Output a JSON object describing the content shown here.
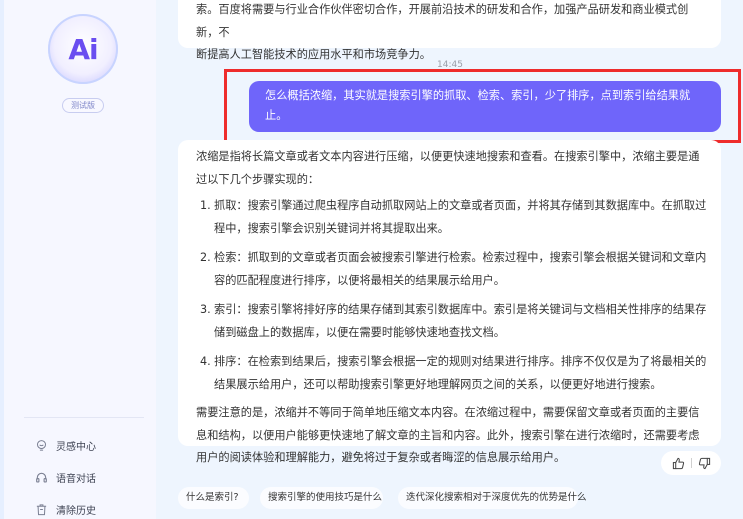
{
  "sidebar": {
    "logo_text": "Ai",
    "badge": "测试版",
    "items": [
      {
        "icon": "lightbulb-icon",
        "label": "灵感中心"
      },
      {
        "icon": "headphones-icon",
        "label": "语音对话"
      },
      {
        "icon": "trash-icon",
        "label": "清除历史"
      }
    ]
  },
  "chat": {
    "previous_reply": {
      "lines": [
        "索。百度将需要与行业合作伙伴密切合作，开展前沿技术的研发和合作，加强产品研发和商业模式创新，不",
        "断提高人工智能技术的应用水平和市场竞争力。"
      ]
    },
    "timestamp": "14:45",
    "user_message": "怎么概括浓缩，其实就是搜索引擎的抓取、检索、索引，少了排序，点到索引给结果就止。",
    "reply": {
      "intro": "浓缩是指将长篇文章或者文本内容进行压缩，以便更快速地搜索和查看。在搜索引擎中，浓缩主要是通过以下几个步骤实现的：",
      "steps": [
        {
          "num": "1.",
          "text": "抓取：搜索引擎通过爬虫程序自动抓取网站上的文章或者页面，并将其存储到其数据库中。在抓取过程中，搜索引擎会识别关键词并将其提取出来。"
        },
        {
          "num": "2.",
          "text": "检索：抓取到的文章或者页面会被搜索引擎进行检索。检索过程中，搜索引擎会根据关键词和文章内容的匹配程度进行排序，以便将最相关的结果展示给用户。"
        },
        {
          "num": "3.",
          "text": "索引：搜索引擎将排好序的结果存储到其索引数据库中。索引是将关键词与文档相关性排序的结果存储到磁盘上的数据库，以便在需要时能够快速地查找文档。"
        },
        {
          "num": "4.",
          "text": "排序：在检索到结果后，搜索引擎会根据一定的规则对结果进行排序。排序不仅仅是为了将最相关的结果展示给用户，还可以帮助搜索引擎更好地理解网页之间的关系，以便更好地进行搜索。"
        }
      ],
      "note": "需要注意的是，浓缩并不等同于简单地压缩文本内容。在浓缩过程中，需要保留文章或者页面的主要信息和结构，以便用户能够更快速地了解文章的主旨和内容。此外，搜索引擎在进行浓缩时，还需要考虑用户的阅读体验和理解能力，避免将过于复杂或者晦涩的信息展示给用户。"
    },
    "feedback": {
      "like_icon": "thumbs-up-icon",
      "dislike_icon": "thumbs-down-icon"
    },
    "suggestions": [
      "什么是索引?",
      "搜索引擎的使用技巧是什么",
      "迭代深化搜索相对于深度优先的优势是什么"
    ]
  },
  "colors": {
    "user_bubble": "#6f65fa",
    "highlight_border": "#ee2c2c",
    "brand": "#6a4ef0"
  }
}
